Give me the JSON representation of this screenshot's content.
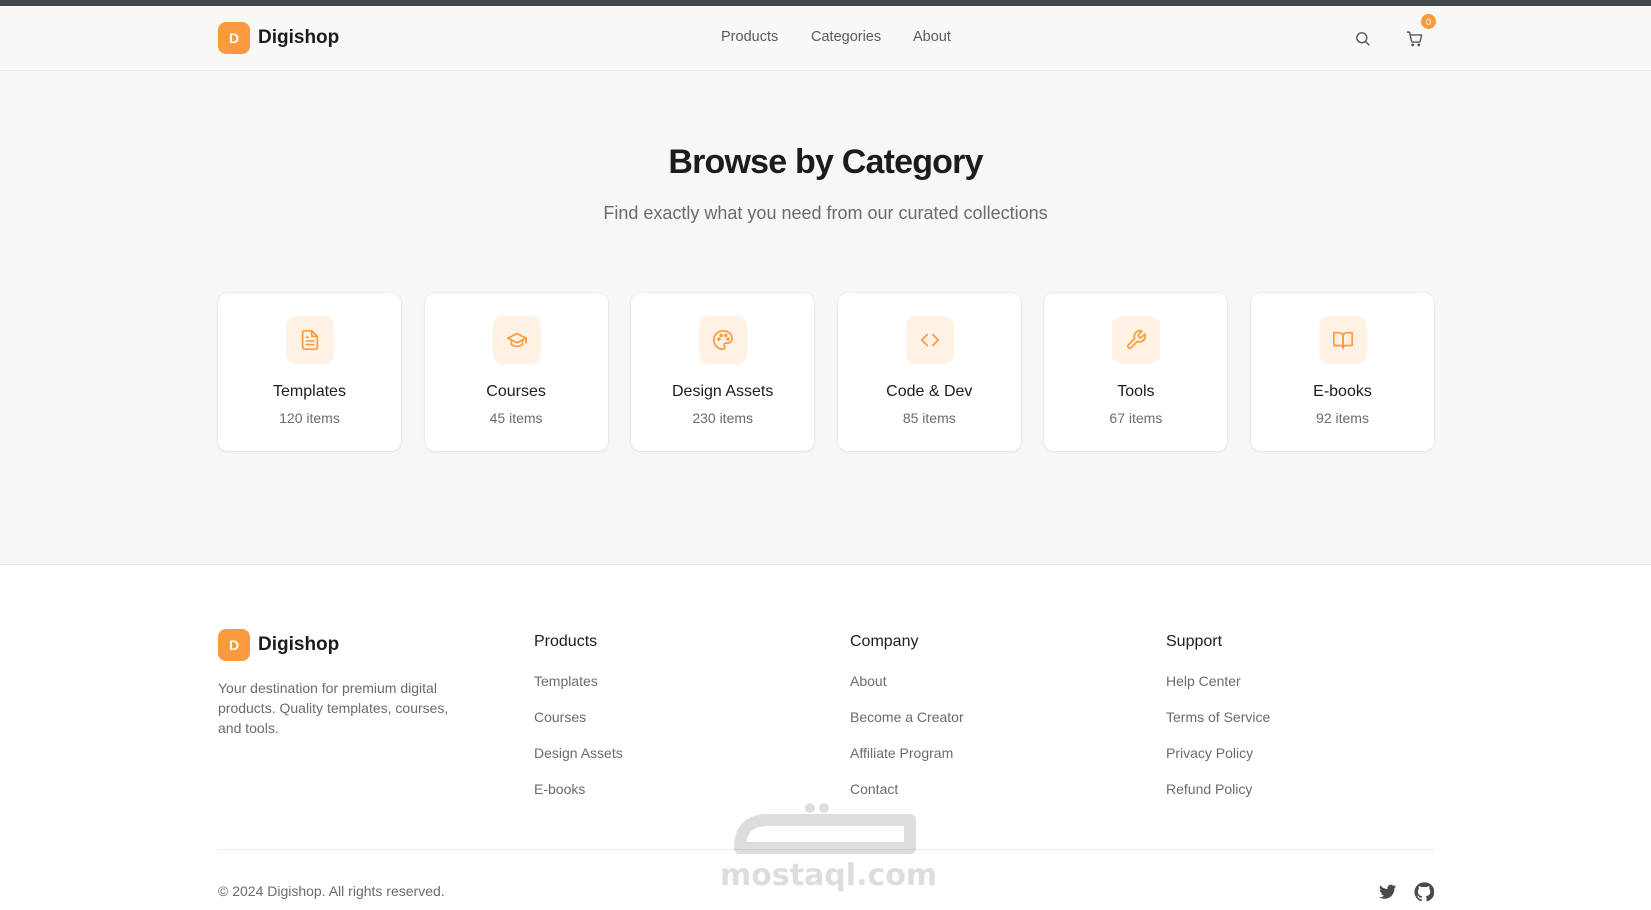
{
  "brand": {
    "initial": "D",
    "name": "Digishop"
  },
  "nav": {
    "products": "Products",
    "categories": "Categories",
    "about": "About"
  },
  "header": {
    "search_icon": "search-icon",
    "cart_icon": "cart-icon",
    "cart_count": "0"
  },
  "hero": {
    "title": "Browse by Category",
    "subtitle": "Find exactly what you need from our curated collections"
  },
  "categories": [
    {
      "name": "Templates",
      "count": "120 items",
      "icon": "document-icon"
    },
    {
      "name": "Courses",
      "count": "45 items",
      "icon": "graduation-cap-icon"
    },
    {
      "name": "Design Assets",
      "count": "230 items",
      "icon": "palette-icon"
    },
    {
      "name": "Code & Dev",
      "count": "85 items",
      "icon": "code-icon"
    },
    {
      "name": "Tools",
      "count": "67 items",
      "icon": "wrench-icon"
    },
    {
      "name": "E-books",
      "count": "92 items",
      "icon": "book-open-icon"
    }
  ],
  "footer": {
    "description": "Your destination for premium digital products. Quality templates, courses, and tools.",
    "columns": [
      {
        "title": "Products",
        "links": [
          "Templates",
          "Courses",
          "Design Assets",
          "E-books"
        ]
      },
      {
        "title": "Company",
        "links": [
          "About",
          "Become a Creator",
          "Affiliate Program",
          "Contact"
        ]
      },
      {
        "title": "Support",
        "links": [
          "Help Center",
          "Terms of Service",
          "Privacy Policy",
          "Refund Policy"
        ]
      }
    ],
    "copyright": "© 2024 Digishop. All rights reserved.",
    "social": [
      "twitter-icon",
      "github-icon"
    ]
  },
  "watermark": {
    "text": "mostaql.com"
  },
  "colors": {
    "accent": "#fb9a3c",
    "accent_soft": "#fff1e4",
    "background": "#f8f7f5",
    "topbar": "#434a4f"
  }
}
